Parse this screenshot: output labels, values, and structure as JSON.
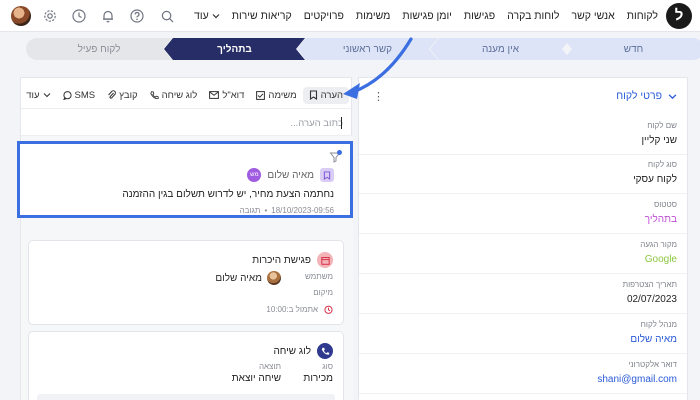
{
  "nav": {
    "logo_letter": "ל",
    "links": [
      "לקוחות",
      "אנשי קשר",
      "לוחות בקרה",
      "פגישות",
      "יומן פגישות",
      "משימות",
      "פרויקטים",
      "קריאות שירות"
    ],
    "more_label": "עוד"
  },
  "stages": {
    "new": "חדש",
    "no_answer": "אין מענה",
    "first_contact": "קשר ראשוני",
    "in_progress": "בתהליך",
    "active_customer": "לקוח פעיל"
  },
  "toolbar": {
    "note": "הערה",
    "task": "משימה",
    "email": "דוא\"ל",
    "call_log": "לוג שיחה",
    "file": "קובץ",
    "sms": "SMS",
    "more": "עוד"
  },
  "note_input": {
    "placeholder": "כתוב הערה..."
  },
  "activity": {
    "note_card": {
      "author_initials": "מש",
      "author": "מאיה שלום",
      "text": "נחתמה הצעת מחיר, יש לדרוש תשלום בגין ההזמנה",
      "timestamp": "18/10/2023-09:56",
      "reply_label": "תגובה"
    },
    "meeting_card": {
      "title": "פגישת היכרות",
      "user_label": "משתמש",
      "user_name": "מאיה שלום",
      "location_label": "מיקום",
      "time_text": "אתמול ב:10:00"
    },
    "call_card": {
      "title": "לוג שיחה",
      "type_label": "סוג",
      "type_value": "מכירות",
      "result_label": "תוצאה",
      "result_value": "שיחה יוצאת"
    }
  },
  "details": {
    "section_title": "פרטי לקוח",
    "fields": [
      {
        "label": "שם לקוח",
        "value": "שני קליין"
      },
      {
        "label": "סוג לקוח",
        "value": "לקוח עסקי"
      },
      {
        "label": "סטטוס",
        "value": "בתהליך"
      },
      {
        "label": "מקור הגעה",
        "value": "Google"
      },
      {
        "label": "תאריך הצטרפות",
        "value": "02/07/2023"
      },
      {
        "label": "מנהל לקוח",
        "value": "מאיה שלום"
      },
      {
        "label": "דואר אלקטרוני",
        "value": "shani@gmail.com"
      }
    ]
  },
  "colors": {
    "accent": "#3b6ee0",
    "stage_active": "#272d66",
    "status_purple": "#c04fd6",
    "source_green": "#8cc63f"
  }
}
